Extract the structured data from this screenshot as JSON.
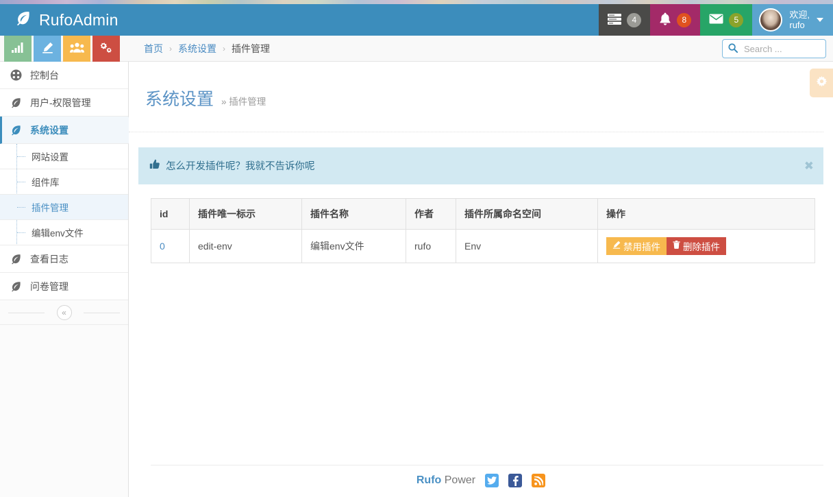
{
  "brand": {
    "name": "RufoAdmin",
    "icon": "leaf-icon"
  },
  "navbar": {
    "tasks": {
      "icon": "tasks-icon",
      "badge": "4"
    },
    "alerts": {
      "icon": "bell-icon",
      "badge": "8"
    },
    "mail": {
      "icon": "envelope-icon",
      "badge": "5"
    },
    "user": {
      "welcome": "欢迎,\nrufo",
      "avatar": "user-avatar",
      "caret": "caret-down-icon"
    }
  },
  "quick_tiles": [
    {
      "name": "chart-tile",
      "icon": "bar-chart-icon",
      "color": "#87c195"
    },
    {
      "name": "edit-tile",
      "icon": "pencil-icon",
      "color": "#6cb2e0"
    },
    {
      "name": "users-tile",
      "icon": "users-icon",
      "color": "#f7b94e"
    },
    {
      "name": "gears-tile",
      "icon": "gears-icon",
      "color": "#cd4e42"
    }
  ],
  "breadcrumb": {
    "home": "首页",
    "section": "系统设置",
    "current": "插件管理",
    "separator": "›"
  },
  "search": {
    "placeholder": "Search ...",
    "value": "",
    "icon": "search-icon"
  },
  "sidebar": {
    "items": [
      {
        "label": "控制台",
        "icon": "dashboard-icon",
        "active": false
      },
      {
        "label": "用户-权限管理",
        "icon": "leaf-icon",
        "active": false
      },
      {
        "label": "系统设置",
        "icon": "leaf-icon",
        "active": true
      },
      {
        "label": "查看日志",
        "icon": "leaf-icon",
        "active": false
      },
      {
        "label": "问卷管理",
        "icon": "leaf-icon",
        "active": false
      }
    ],
    "submenu": [
      {
        "label": "网站设置",
        "active": false
      },
      {
        "label": "组件库",
        "active": false
      },
      {
        "label": "插件管理",
        "active": true
      },
      {
        "label": "编辑env文件",
        "active": false
      }
    ],
    "collapse_icon": "chevron-double-left-icon"
  },
  "page": {
    "title": "系统设置",
    "subtitle": "» 插件管理",
    "gear_tab_icon": "gear-icon"
  },
  "alert": {
    "icon": "thumbs-up-icon",
    "message": "怎么开发插件呢？我就不告诉你呢",
    "close_icon": "close-icon",
    "background": "#d2e9f2",
    "text_color": "#31708f"
  },
  "table": {
    "columns": [
      "id",
      "插件唯一标示",
      "插件名称",
      "作者",
      "插件所属命名空间",
      "操作"
    ],
    "rows": [
      {
        "id": "0",
        "key": "edit-env",
        "name": "编辑env文件",
        "author": "rufo",
        "namespace": "Env",
        "actions": [
          {
            "label": "禁用插件",
            "icon": "pencil-icon",
            "color": "#f7b94e"
          },
          {
            "label": "删除插件",
            "icon": "trash-icon",
            "color": "#cd4e42"
          }
        ]
      }
    ]
  },
  "footer": {
    "power_brand": "Rufo",
    "power_text": " Power",
    "social": [
      {
        "name": "twitter-icon",
        "color": "#55acee"
      },
      {
        "name": "facebook-icon",
        "color": "#3b5998"
      },
      {
        "name": "rss-icon",
        "color": "#f7941d"
      }
    ]
  }
}
